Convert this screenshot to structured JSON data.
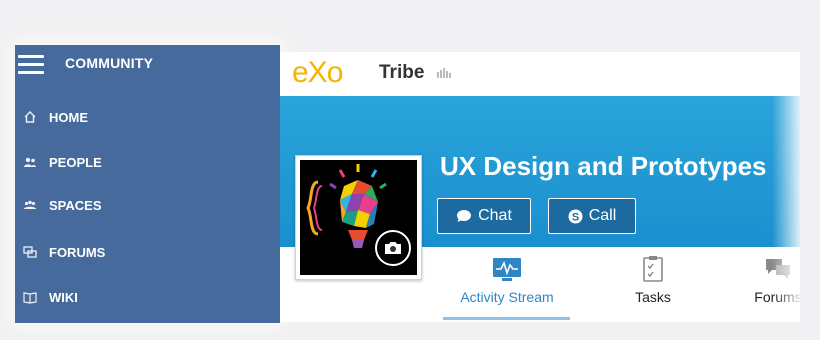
{
  "sidebar": {
    "title": "COMMUNITY",
    "items": [
      {
        "label": "HOME",
        "icon": "home-icon"
      },
      {
        "label": "PEOPLE",
        "icon": "people-icon"
      },
      {
        "label": "SPACES",
        "icon": "spaces-icon"
      },
      {
        "label": "FORUMS",
        "icon": "forums-icon"
      },
      {
        "label": "WIKI",
        "icon": "wiki-icon"
      }
    ]
  },
  "header": {
    "logo_text": "eXo",
    "space_name": "Tribe"
  },
  "space": {
    "title": "UX Design and Prototypes",
    "chat_label": "Chat",
    "call_label": "Call"
  },
  "tabs": [
    {
      "label": "Activity Stream",
      "icon": "activity-stream-icon",
      "active": true
    },
    {
      "label": "Tasks",
      "icon": "tasks-icon",
      "active": false
    },
    {
      "label": "Forums",
      "icon": "forums-tab-icon",
      "active": false
    }
  ],
  "colors": {
    "sidebar_bg": "#476a9c",
    "banner_bg": "#1a8fcf",
    "button_bg": "#1d6aa1",
    "logo": "#f5b400",
    "active_tab_text": "#2f86c4"
  }
}
